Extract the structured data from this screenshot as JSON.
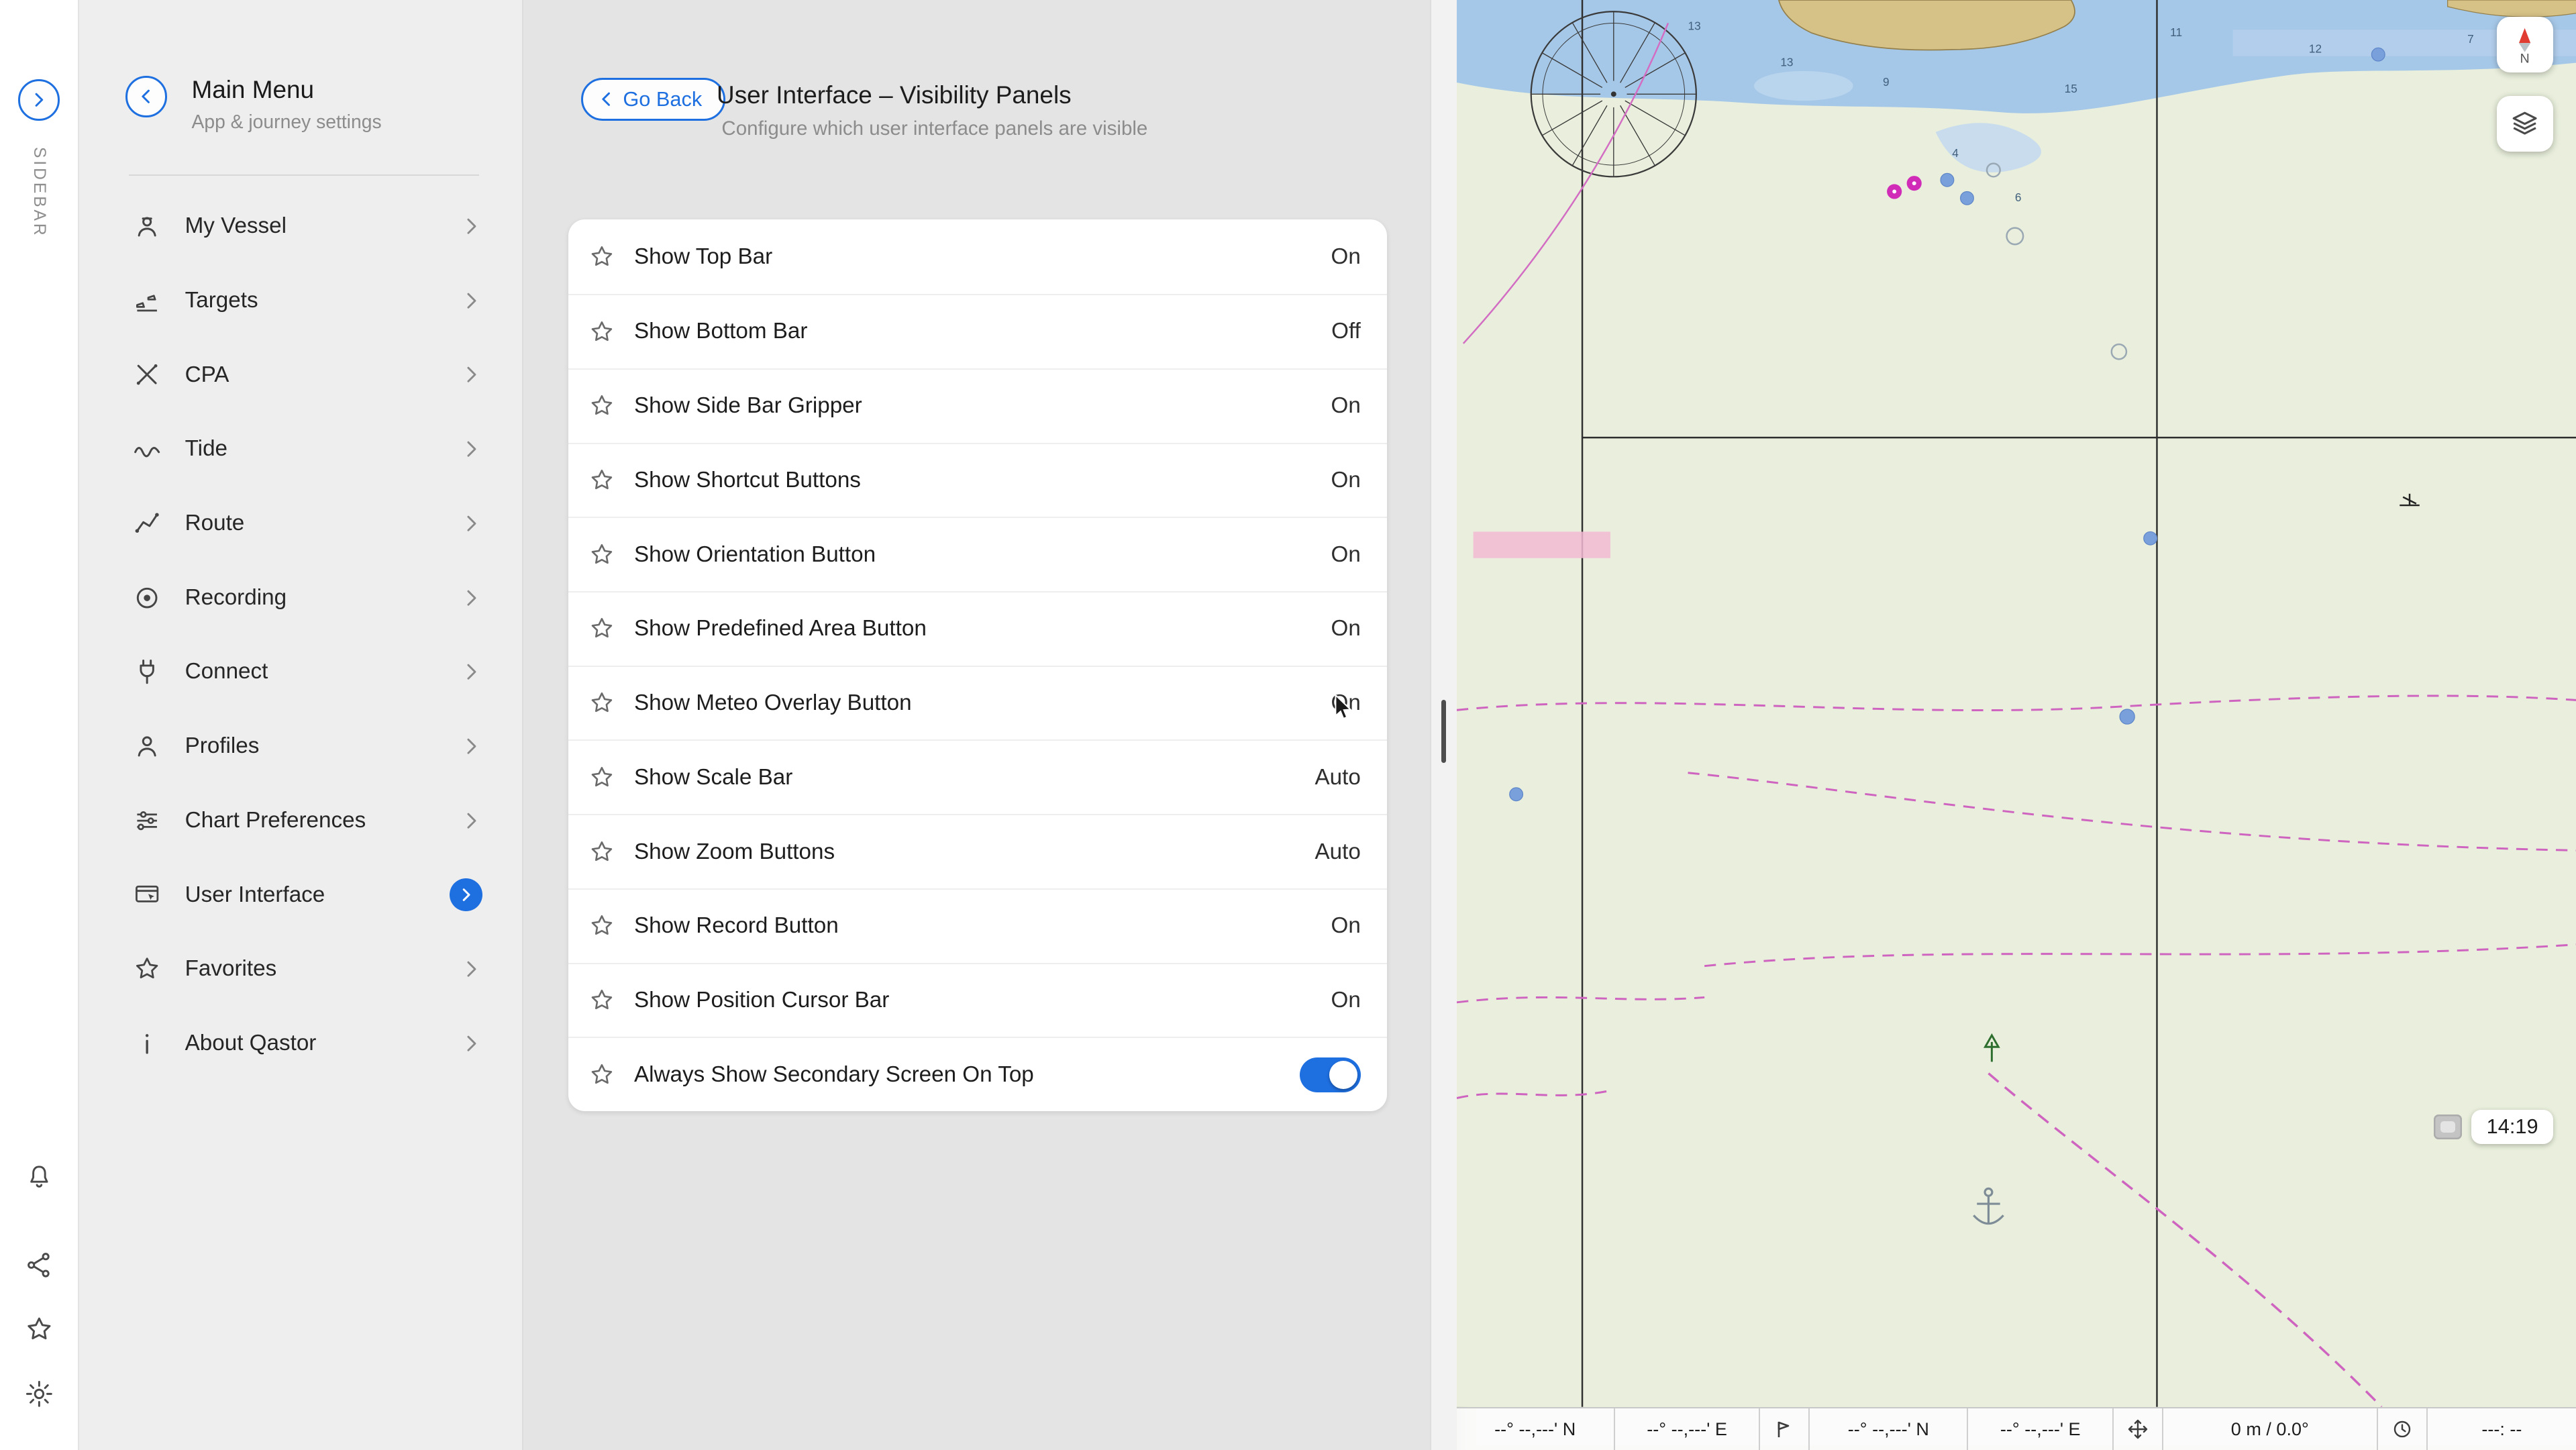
{
  "accent": "#1e6fe0",
  "rail": {
    "label": "SIDEBAR"
  },
  "menu": {
    "title": "Main Menu",
    "subtitle": "App & journey settings",
    "items": [
      {
        "label": "My Vessel"
      },
      {
        "label": "Targets"
      },
      {
        "label": "CPA"
      },
      {
        "label": "Tide"
      },
      {
        "label": "Route"
      },
      {
        "label": "Recording"
      },
      {
        "label": "Connect"
      },
      {
        "label": "Profiles"
      },
      {
        "label": "Chart Preferences"
      },
      {
        "label": "User Interface",
        "selected": true
      },
      {
        "label": "Favorites"
      },
      {
        "label": "About Qastor"
      }
    ]
  },
  "panel": {
    "back_label": "Go Back",
    "title": "User Interface – Visibility Panels",
    "subtitle": "Configure which user interface panels are visible",
    "rows": [
      {
        "label": "Show Top Bar",
        "value": "On"
      },
      {
        "label": "Show Bottom Bar",
        "value": "Off"
      },
      {
        "label": "Show Side Bar Gripper",
        "value": "On"
      },
      {
        "label": "Show Shortcut Buttons",
        "value": "On"
      },
      {
        "label": "Show Orientation Button",
        "value": "On"
      },
      {
        "label": "Show Predefined Area Button",
        "value": "On"
      },
      {
        "label": "Show Meteo Overlay Button",
        "value": "On"
      },
      {
        "label": "Show Scale Bar",
        "value": "Auto"
      },
      {
        "label": "Show Zoom Buttons",
        "value": "Auto"
      },
      {
        "label": "Show Record Button",
        "value": "On"
      },
      {
        "label": "Show Position Cursor Bar",
        "value": "On"
      },
      {
        "label": "Always Show Secondary Screen On Top",
        "value": "On",
        "control": "toggle"
      }
    ]
  },
  "map": {
    "compass_label": "N",
    "clock_badge": "14:19",
    "status": {
      "cursor_lat": "--° --,---' N",
      "cursor_lon": "--° --,---' E",
      "vessel_lat": "--° --,---' N",
      "vessel_lon": "--° --,---' E",
      "speed_course": "0 m / 0.0°",
      "eta": "---: --"
    },
    "depths": [
      "13",
      "13",
      "9",
      "4",
      "6",
      "11",
      "12",
      "7",
      "15"
    ],
    "colors": {
      "water": "#a6c8e8",
      "land": "#d6c286",
      "chart_bg": "#e9efdc",
      "cable_magenta": "#cf63c0"
    }
  }
}
